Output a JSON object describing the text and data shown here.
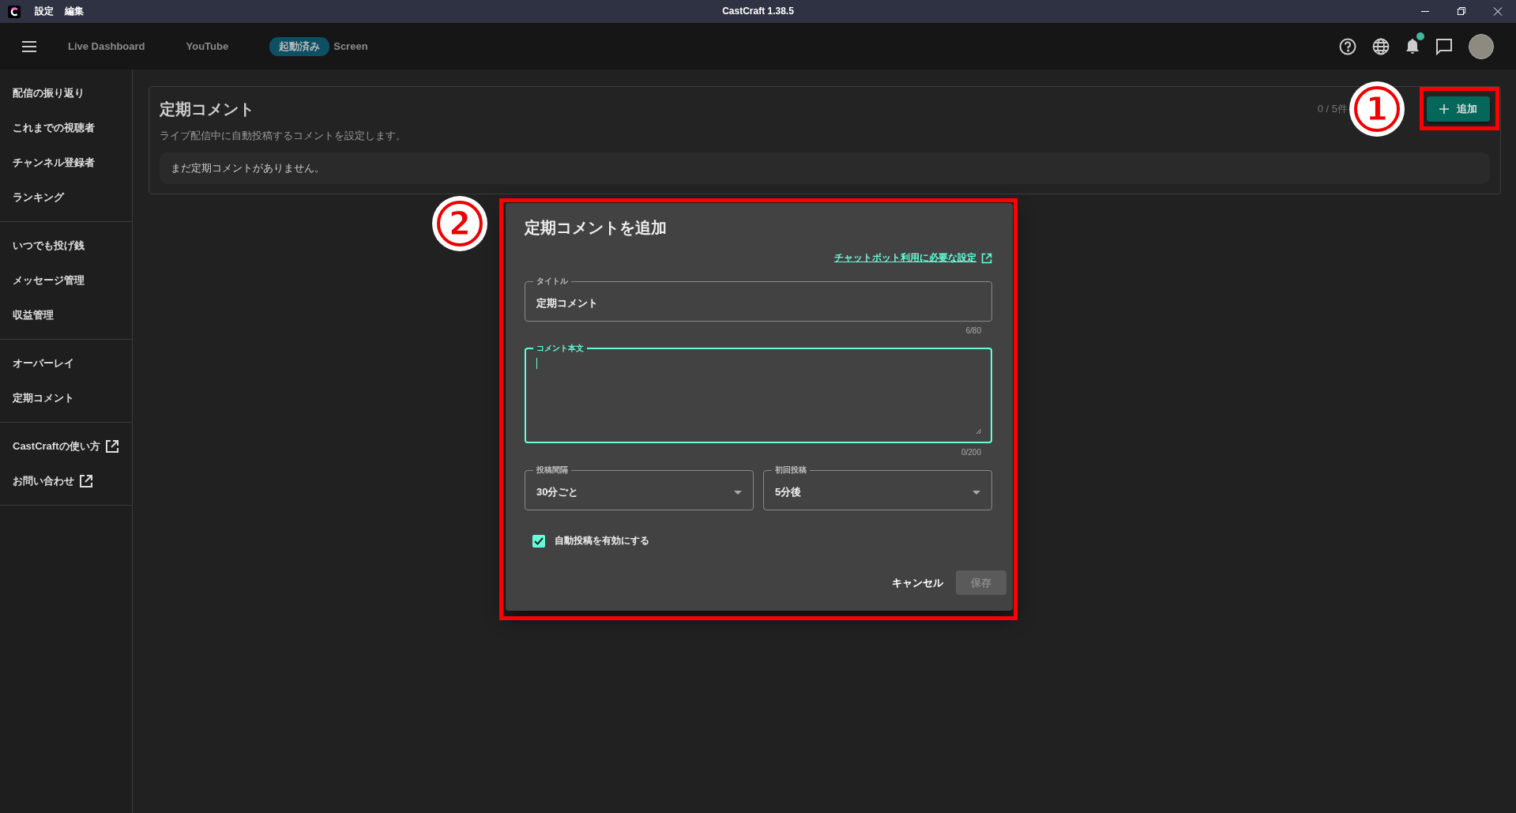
{
  "titlebar": {
    "menu": [
      "設定",
      "編集"
    ],
    "title": "CastCraft 1.38.5"
  },
  "nav": {
    "links": [
      "Live Dashboard",
      "YouTube"
    ],
    "screen": {
      "badge": "起動済み",
      "label": "Screen"
    },
    "notification_unread": true
  },
  "sidebar": {
    "groups": [
      {
        "items": [
          {
            "label": "配信の振り返り",
            "external": false
          },
          {
            "label": "これまでの視聴者",
            "external": false
          },
          {
            "label": "チャンネル登録者",
            "external": false
          },
          {
            "label": "ランキング",
            "external": false
          }
        ]
      },
      {
        "items": [
          {
            "label": "いつでも投げ銭",
            "external": false
          },
          {
            "label": "メッセージ管理",
            "external": false
          },
          {
            "label": "収益管理",
            "external": false
          }
        ]
      },
      {
        "items": [
          {
            "label": "オーバーレイ",
            "external": false
          },
          {
            "label": "定期コメント",
            "external": false
          }
        ]
      },
      {
        "items": [
          {
            "label": "CastCraftの使い方",
            "external": true
          },
          {
            "label": "お問い合わせ",
            "external": true
          }
        ]
      }
    ]
  },
  "page": {
    "title": "定期コメント",
    "description": "ライブ配信中に自動投稿するコメントを設定します。",
    "count": "0 / 5件",
    "add_button": "追加",
    "empty_message": "まだ定期コメントがありません。"
  },
  "dialog": {
    "title": "定期コメントを追加",
    "help_link": "チャットボット利用に必要な設定",
    "title_field": {
      "label": "タイトル",
      "value": "定期コメント",
      "counter": "6/80",
      "focused": false
    },
    "body_field": {
      "label": "コメント本文",
      "counter": "0/200",
      "focused": true
    },
    "selects": [
      {
        "label": "投稿間隔",
        "value": "30分ごと"
      },
      {
        "label": "初回投稿",
        "value": "5分後"
      }
    ],
    "checkbox": {
      "label": "自動投稿を有効にする",
      "checked": true
    },
    "cancel_button": "キャンセル",
    "save_button": {
      "label": "保存",
      "disabled": true
    }
  },
  "annotations": [
    {
      "number": "1"
    },
    {
      "number": "2"
    }
  ]
}
